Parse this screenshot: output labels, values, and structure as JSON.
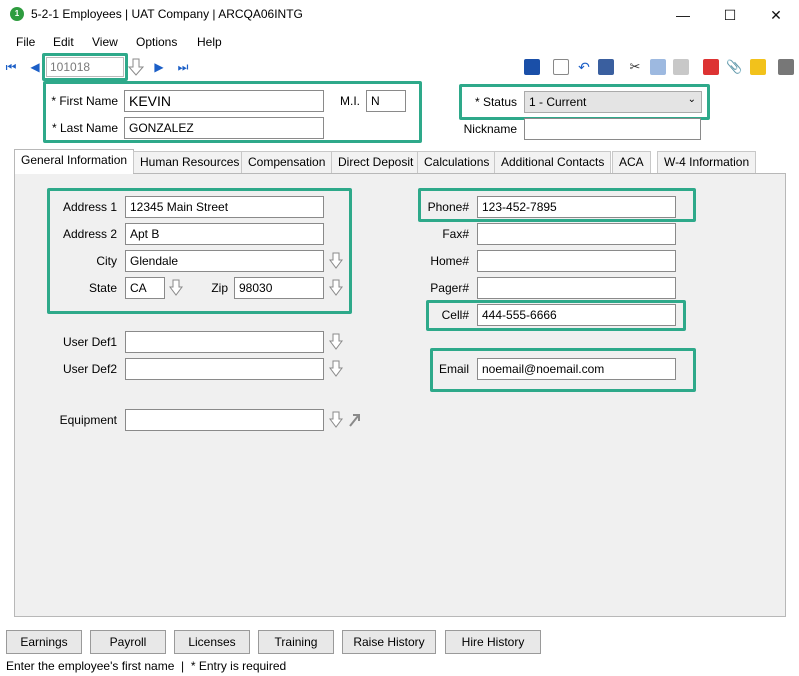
{
  "window": {
    "title": "5-2-1 Employees | UAT Company | ARCQA06INTG",
    "minimize": "—",
    "maximize": "☐",
    "close": "✕"
  },
  "menu": [
    "File",
    "Edit",
    "View",
    "Options",
    "Help"
  ],
  "toolbar": {
    "record_id": "101018"
  },
  "header": {
    "first_name_label": "* First Name",
    "first_name": "KEVIN",
    "last_name_label": "* Last Name",
    "last_name": "GONZALEZ",
    "mi_label": "M.I.",
    "mi": "N",
    "status_label": "* Status",
    "status": "1 - Current",
    "nickname_label": "Nickname",
    "nickname": ""
  },
  "tabs": [
    "General Information",
    "Human Resources",
    "Compensation",
    "Direct Deposit",
    "Calculations",
    "Additional Contacts",
    "ACA",
    "W-4 Information"
  ],
  "general": {
    "address1_label": "Address 1",
    "address1": "12345 Main Street",
    "address2_label": "Address 2",
    "address2": "Apt B",
    "city_label": "City",
    "city": "Glendale",
    "state_label": "State",
    "state": "CA",
    "zip_label": "Zip",
    "zip": "98030",
    "userdef1_label": "User Def1",
    "userdef1": "",
    "userdef2_label": "User Def2",
    "userdef2": "",
    "equipment_label": "Equipment",
    "equipment": "",
    "phone_label": "Phone#",
    "phone": "123-452-7895",
    "fax_label": "Fax#",
    "fax": "",
    "home_label": "Home#",
    "home": "",
    "pager_label": "Pager#",
    "pager": "",
    "cell_label": "Cell#",
    "cell": "444-555-6666",
    "email_label": "Email",
    "email": "noemail@noemail.com"
  },
  "bottom_buttons": [
    "Earnings",
    "Payroll",
    "Licenses",
    "Training",
    "Raise History",
    "Hire History"
  ],
  "status_bar": "Enter the employee's first name  |  * Entry is required",
  "colors": {
    "highlight": "#2ea98a",
    "nav_arrow": "#1c5fc7"
  }
}
